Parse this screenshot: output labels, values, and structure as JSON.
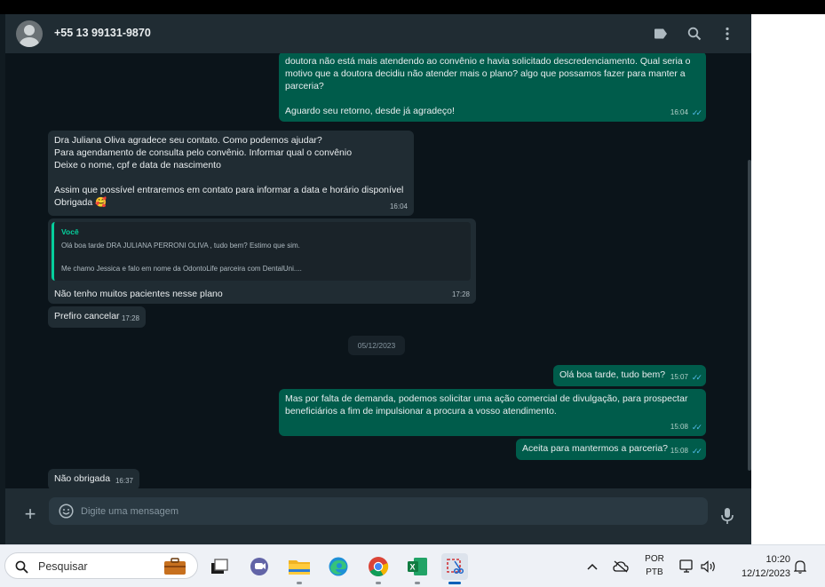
{
  "header": {
    "contact_name": "+55 13 99131-9870",
    "icons": [
      "label-icon",
      "search-icon",
      "kebab-menu-icon"
    ]
  },
  "messages": [
    {
      "direction": "outgoing",
      "text": "doutora não está mais atendendo ao convênio e havia solicitado descredenciamento. Qual seria o motivo que a doutora decidiu não atender mais o plano? algo que possamos fazer para manter a parceria?\n\nAguardo seu retorno, desde já agradeço!",
      "time": "16:04",
      "status": "read"
    },
    {
      "direction": "incoming",
      "text": "Dra Juliana Oliva agradece seu contato. Como podemos ajudar?\nPara agendamento de consulta pelo convênio. Informar qual o convênio\nDeixe  o nome, cpf e data de nascimento\n\nAssim que possível entraremos em contato para informar a data e horário disponível\nObrigada 🥰",
      "time": "16:04"
    },
    {
      "direction": "incoming",
      "quoted": {
        "author": "Você",
        "text": "Olá boa tarde DRA JULIANA PERRONI OLIVA , tudo bem? Estimo que sim.\n\nMe chamo Jessica e falo em nome da OdontoLife parceira com DentalUni...."
      },
      "text": "Não tenho muitos pacientes nesse plano",
      "time": "17:28"
    },
    {
      "direction": "incoming",
      "text": "Prefiro cancelar",
      "time": "17:28"
    },
    {
      "direction": "outgoing",
      "text": "Olá boa tarde, tudo bem?",
      "time": "15:07",
      "status": "read"
    },
    {
      "direction": "outgoing",
      "text": "Mas por falta de demanda, podemos solicitar uma ação comercial de divulgação, para prospectar beneficiários a fim de impulsionar a procura a vosso atendimento.",
      "time": "15:08",
      "status": "read"
    },
    {
      "direction": "outgoing",
      "text": "Aceita para mantermos a parceria?",
      "time": "15:08",
      "status": "read"
    },
    {
      "direction": "incoming",
      "text": "Não obrigada",
      "time": "16:37"
    }
  ],
  "date_separator": "05/12/2023",
  "composer": {
    "placeholder": "Digite uma mensagem"
  },
  "taskbar": {
    "search_label": "Pesquisar",
    "apps": [
      "briefcase-widget",
      "task-view",
      "teams",
      "file-explorer",
      "edge",
      "chrome",
      "excel",
      "snipping-tool"
    ],
    "language": "POR",
    "keyboard": "PTB",
    "time": "10:20",
    "date": "12/12/2023"
  },
  "colors": {
    "chat_background": "#0b141a",
    "header_background": "#202c33",
    "incoming_bubble": "#202c33",
    "outgoing_bubble": "#005c4b",
    "read_ticks": "#53bdeb",
    "quote_accent": "#06cf9c"
  }
}
